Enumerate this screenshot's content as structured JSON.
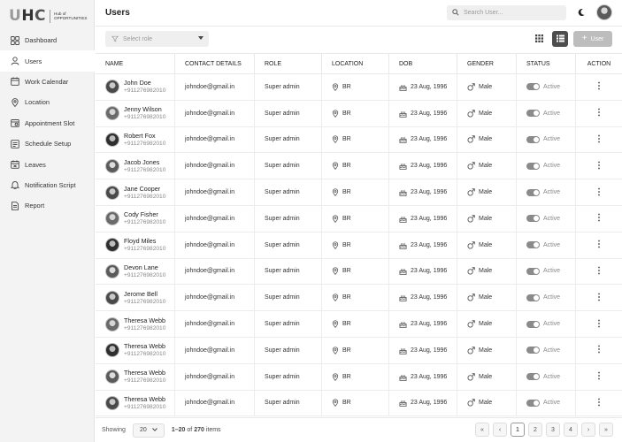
{
  "brand": {
    "mark_u": "U",
    "mark_h": "H",
    "mark_c": "C",
    "tagline_1": "Hub of",
    "tagline_2": "OPPORTUNITIES"
  },
  "sidebar": {
    "items": [
      {
        "label": "Dashboard",
        "icon": "dashboard-icon"
      },
      {
        "label": "Users",
        "icon": "user-icon",
        "active": true
      },
      {
        "label": "Work Calendar",
        "icon": "calendar-icon"
      },
      {
        "label": "Location",
        "icon": "location-icon"
      },
      {
        "label": "Appointment Slot",
        "icon": "appointment-icon"
      },
      {
        "label": "Schedule Setup",
        "icon": "schedule-icon"
      },
      {
        "label": "Leaves",
        "icon": "leaves-icon"
      },
      {
        "label": "Notification Script",
        "icon": "bell-icon"
      },
      {
        "label": "Report",
        "icon": "report-icon"
      }
    ]
  },
  "header": {
    "title": "Users",
    "search_placeholder": "Search User..."
  },
  "toolbar": {
    "select_role_placeholder": "Select role",
    "add_user_label": "User"
  },
  "table": {
    "columns": [
      "NAME",
      "CONTACT DETAILS",
      "ROLE",
      "LOCATION",
      "DOB",
      "GENDER",
      "STATUS",
      "ACTION"
    ],
    "rows": [
      {
        "name": "John Doe",
        "phone": "+911276982010",
        "email": "johndoe@gmail.in",
        "role": "Super admin",
        "location": "BR",
        "dob": "23 Aug, 1996",
        "gender": "Male",
        "status": "Active"
      },
      {
        "name": "Jenny Wilson",
        "phone": "+911276982010",
        "email": "johndoe@gmail.in",
        "role": "Super admin",
        "location": "BR",
        "dob": "23 Aug, 1996",
        "gender": "Male",
        "status": "Active"
      },
      {
        "name": "Robert Fox",
        "phone": "+911276982010",
        "email": "johndoe@gmail.in",
        "role": "Super admin",
        "location": "BR",
        "dob": "23 Aug, 1996",
        "gender": "Male",
        "status": "Active"
      },
      {
        "name": "Jacob Jones",
        "phone": "+911276982010",
        "email": "johndoe@gmail.in",
        "role": "Super admin",
        "location": "BR",
        "dob": "23 Aug, 1996",
        "gender": "Male",
        "status": "Active"
      },
      {
        "name": "Jane Cooper",
        "phone": "+911276982010",
        "email": "johndoe@gmail.in",
        "role": "Super admin",
        "location": "BR",
        "dob": "23 Aug, 1996",
        "gender": "Male",
        "status": "Active"
      },
      {
        "name": "Cody Fisher",
        "phone": "+911276982010",
        "email": "johndoe@gmail.in",
        "role": "Super admin",
        "location": "BR",
        "dob": "23 Aug, 1996",
        "gender": "Male",
        "status": "Active"
      },
      {
        "name": "Floyd Miles",
        "phone": "+911276982010",
        "email": "johndoe@gmail.in",
        "role": "Super admin",
        "location": "BR",
        "dob": "23 Aug, 1996",
        "gender": "Male",
        "status": "Active"
      },
      {
        "name": "Devon Lane",
        "phone": "+911276982010",
        "email": "johndoe@gmail.in",
        "role": "Super admin",
        "location": "BR",
        "dob": "23 Aug, 1996",
        "gender": "Male",
        "status": "Active"
      },
      {
        "name": "Jerome Bell",
        "phone": "+911276982010",
        "email": "johndoe@gmail.in",
        "role": "Super admin",
        "location": "BR",
        "dob": "23 Aug, 1996",
        "gender": "Male",
        "status": "Active"
      },
      {
        "name": "Theresa Webb",
        "phone": "+911276982010",
        "email": "johndoe@gmail.in",
        "role": "Super admin",
        "location": "BR",
        "dob": "23 Aug, 1996",
        "gender": "Male",
        "status": "Active"
      },
      {
        "name": "Theresa Webb",
        "phone": "+911276982010",
        "email": "johndoe@gmail.in",
        "role": "Super admin",
        "location": "BR",
        "dob": "23 Aug, 1996",
        "gender": "Male",
        "status": "Active"
      },
      {
        "name": "Theresa Webb",
        "phone": "+911276982010",
        "email": "johndoe@gmail.in",
        "role": "Super admin",
        "location": "BR",
        "dob": "23 Aug, 1996",
        "gender": "Male",
        "status": "Active"
      },
      {
        "name": "Theresa Webb",
        "phone": "+911276982010",
        "email": "johndoe@gmail.in",
        "role": "Super admin",
        "location": "BR",
        "dob": "23 Aug, 1996",
        "gender": "Male",
        "status": "Active"
      }
    ]
  },
  "footer": {
    "showing_label": "Showing",
    "per_page": "20",
    "range_text": "1–20",
    "of_text": "of",
    "total": "270",
    "items_text": "items",
    "pages": [
      "1",
      "2",
      "3",
      "4"
    ],
    "current_page": "1"
  },
  "colors": {
    "accent": "#4d4d4d",
    "toggle_on": "#8a8a8a",
    "sidebar_bg": "#f3f3f3"
  }
}
